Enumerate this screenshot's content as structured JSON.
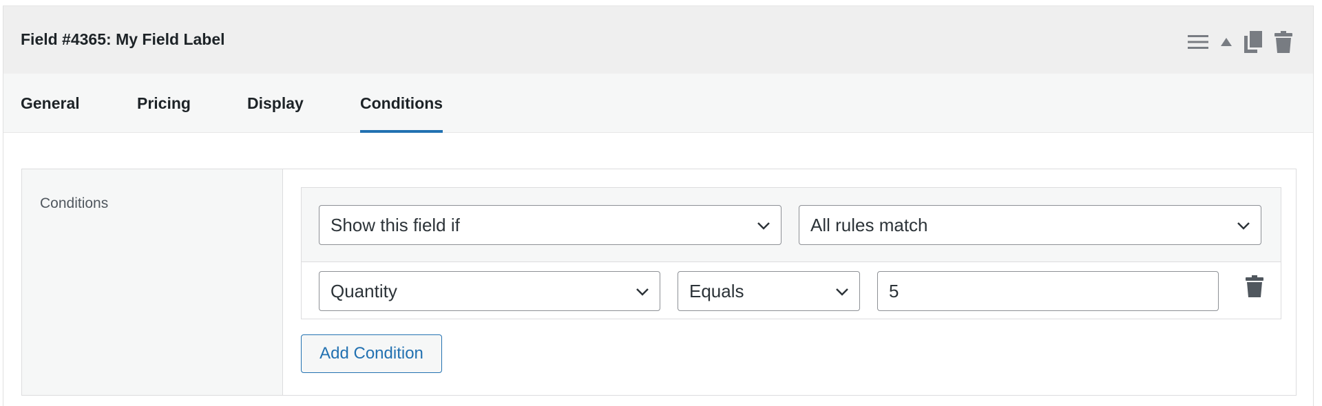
{
  "field": {
    "title": "Field #4365: My Field Label"
  },
  "header_actions": [
    {
      "icon": "menu-icon"
    },
    {
      "icon": "collapse-triangle-icon"
    },
    {
      "icon": "duplicate-icon"
    },
    {
      "icon": "trash-icon"
    }
  ],
  "tabs": [
    {
      "label": "General",
      "active": false
    },
    {
      "label": "Pricing",
      "active": false
    },
    {
      "label": "Display",
      "active": false
    },
    {
      "label": "Conditions",
      "active": true
    }
  ],
  "conditions": {
    "section_label": "Conditions",
    "visibility_select": "Show this field if",
    "match_select": "All rules match",
    "rule": {
      "field_select": "Quantity",
      "operator_select": "Equals",
      "value": "5"
    },
    "add_button": "Add Condition"
  },
  "colors": {
    "accent": "#2271b1",
    "header_bg": "#efefef",
    "tabs_bg": "#f6f7f7",
    "icon": "#787c82"
  }
}
